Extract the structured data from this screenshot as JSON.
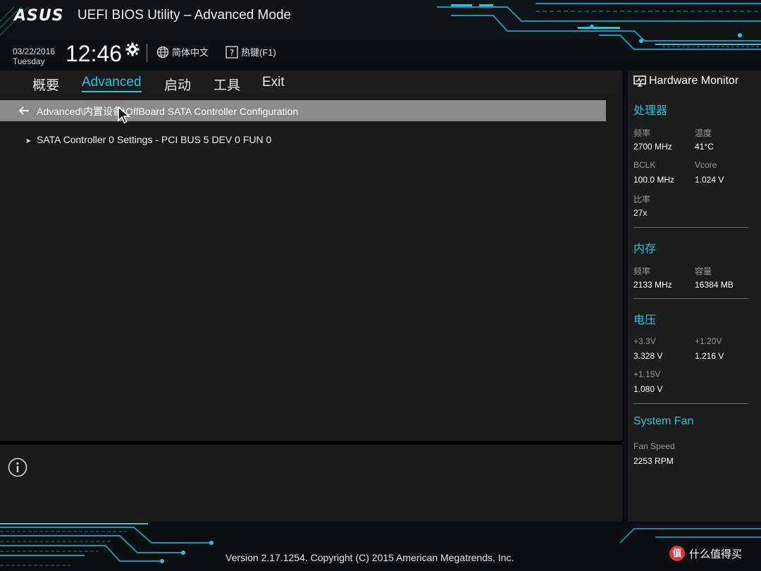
{
  "header": {
    "logo": "ASUS",
    "title": "UEFI BIOS Utility – Advanced Mode",
    "date": "03/22/2016",
    "weekday": "Tuesday",
    "time": "12:46",
    "language": "简体中文",
    "hotkey": "热键(F1)"
  },
  "tabs": [
    {
      "label": "概要"
    },
    {
      "label": "Advanced",
      "active": true
    },
    {
      "label": "启动"
    },
    {
      "label": "工具"
    },
    {
      "label": "Exit"
    }
  ],
  "breadcrumb": "Advanced\\内置设备\\OffBoard SATA Controller Configuration",
  "menu_items": [
    {
      "label": "SATA Controller 0 Settings - PCI BUS 5 DEV 0 FUN 0"
    }
  ],
  "hardware_monitor": {
    "title": "Hardware Monitor",
    "cpu": {
      "heading": "处理器",
      "freq_label": "频率",
      "freq_value": "2700 MHz",
      "temp_label": "温度",
      "temp_value": "41°C",
      "bclk_label": "BCLK",
      "bclk_value": "100.0 MHz",
      "vcore_label": "Vcore",
      "vcore_value": "1.024 V",
      "ratio_label": "比率",
      "ratio_value": "27x"
    },
    "memory": {
      "heading": "内存",
      "freq_label": "频率",
      "freq_value": "2133 MHz",
      "cap_label": "容量",
      "cap_value": "16384 MB"
    },
    "voltage": {
      "heading": "电压",
      "v33_label": "+3.3V",
      "v33_value": "3.328 V",
      "v120_label": "+1.20V",
      "v120_value": "1.216 V",
      "v115_label": "+1.15V",
      "v115_value": "1.080 V"
    },
    "fan": {
      "heading": "System Fan",
      "speed_label": "Fan Speed",
      "speed_value": "2253 RPM"
    }
  },
  "footer": {
    "version": "Version 2.17.1254. Copyright (C) 2015 American Megatrends, Inc.",
    "watermark_badge": "值",
    "watermark_text": "什么值得买"
  },
  "colors": {
    "accent": "#27c2dc",
    "panel": "#1c1c1c",
    "breadcrumb_bar": "#8a8a8a"
  }
}
